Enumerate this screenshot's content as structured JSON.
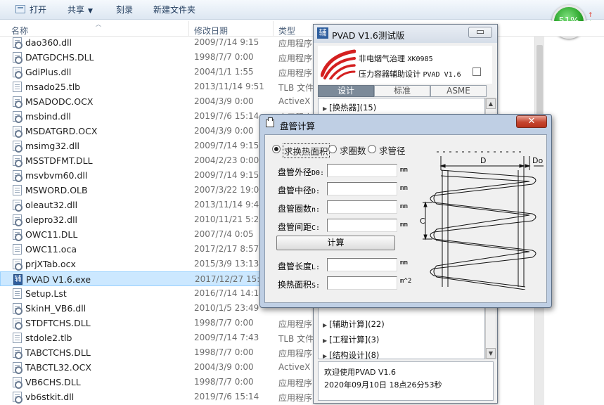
{
  "toolbar": {
    "open_label": "打开",
    "share_label": "共享",
    "burn_label": "刻录",
    "new_folder_label": "新建文件夹"
  },
  "gauge": {
    "percent_label": "51%"
  },
  "columns": {
    "name": "名称",
    "modified": "修改日期",
    "type": "类型"
  },
  "files": [
    {
      "name": "dao360.dll",
      "date": "2009/7/14 9:15",
      "type": "应用程序",
      "icon": "gear"
    },
    {
      "name": "DATGDCHS.DLL",
      "date": "1998/7/7 0:00",
      "type": "应用程序",
      "icon": "gear"
    },
    {
      "name": "GdiPlus.dll",
      "date": "2004/1/1 1:55",
      "type": "应用程序",
      "icon": "gear"
    },
    {
      "name": "msado25.tlb",
      "date": "2013/11/14 9:51",
      "type": "TLB 文件",
      "icon": "doc"
    },
    {
      "name": "MSADODC.OCX",
      "date": "2004/3/9 0:00",
      "type": "ActiveX",
      "icon": "gear"
    },
    {
      "name": "msbind.dll",
      "date": "2019/7/6 15:14",
      "type": "应用程序",
      "icon": "gear"
    },
    {
      "name": "MSDATGRD.OCX",
      "date": "2004/3/9 0:00",
      "type": "ActiveX",
      "icon": "gear"
    },
    {
      "name": "msimg32.dll",
      "date": "2009/7/14 9:15",
      "type": "应用程序",
      "icon": "gear"
    },
    {
      "name": "MSSTDFMT.DLL",
      "date": "2004/2/23 0:00",
      "type": "应用程序",
      "icon": "gear"
    },
    {
      "name": "msvbvm60.dll",
      "date": "2009/7/14 9:15",
      "type": "应用程序",
      "icon": "gear"
    },
    {
      "name": "MSWORD.OLB",
      "date": "2007/3/22 19:05",
      "type": "",
      "icon": "doc"
    },
    {
      "name": "oleaut32.dll",
      "date": "2013/11/14 9:48",
      "type": "",
      "icon": "gear"
    },
    {
      "name": "olepro32.dll",
      "date": "2010/11/21 5:29",
      "type": "",
      "icon": "gear"
    },
    {
      "name": "OWC11.DLL",
      "date": "2007/7/4 0:05",
      "type": "",
      "icon": "gear"
    },
    {
      "name": "OWC11.oca",
      "date": "2017/2/17 8:57",
      "type": "",
      "icon": "doc"
    },
    {
      "name": "prjXTab.ocx",
      "date": "2015/3/9 13:13",
      "type": "",
      "icon": "gear"
    },
    {
      "name": "PVAD V1.6.exe",
      "date": "2017/12/27 15:2",
      "type": "",
      "icon": "exe"
    },
    {
      "name": "Setup.Lst",
      "date": "2016/7/14 14:14",
      "type": "",
      "icon": "doc"
    },
    {
      "name": "SkinH_VB6.dll",
      "date": "2010/1/5 23:49",
      "type": "",
      "icon": "gear"
    },
    {
      "name": "STDFTCHS.DLL",
      "date": "1998/7/7 0:00",
      "type": "应用程序",
      "icon": "gear"
    },
    {
      "name": "stdole2.tlb",
      "date": "2009/7/14 7:43",
      "type": "TLB 文件",
      "icon": "doc"
    },
    {
      "name": "TABCTCHS.DLL",
      "date": "1998/7/7 0:00",
      "type": "应用程序",
      "icon": "gear"
    },
    {
      "name": "TABCTL32.OCX",
      "date": "2004/3/9 0:00",
      "type": "ActiveX",
      "icon": "gear"
    },
    {
      "name": "VB6CHS.DLL",
      "date": "1998/7/7 0:00",
      "type": "应用程序",
      "icon": "gear"
    },
    {
      "name": "vb6stkit.dll",
      "date": "2019/7/6 15:14",
      "type": "应用程序",
      "icon": "gear"
    }
  ],
  "pvad": {
    "title": "PVAD  V1.6测试版",
    "close_glyph": "▭",
    "brand_line1_cn": "非电烟气治理 ",
    "brand_line1_en": "XK0985",
    "brand_line2_cn": "压力容器辅助设计 ",
    "brand_line2_en": "PVAD V1.6",
    "tabs": [
      "设计",
      "标准",
      "ASME"
    ],
    "tree_items": [
      "[换热器](15)",
      "[辅助计算](22)",
      "[工程计算](3)",
      "[结构设计](8)"
    ],
    "status_line1": "欢迎使用PVAD V1.6",
    "status_line2": "2020年09月10日 18点26分53秒"
  },
  "dialog": {
    "title": "盘管计算",
    "close_glyph": "✕",
    "radio_options": [
      "求换热面积",
      "求圈数",
      "求管径"
    ],
    "selected_radio": 0,
    "fields": [
      {
        "label_cn": "盘管外径",
        "label_en": "D0:",
        "value": "",
        "unit": "mm"
      },
      {
        "label_cn": "盘管中径",
        "label_en": "D:",
        "value": "",
        "unit": "mm"
      },
      {
        "label_cn": "盘管圈数",
        "label_en": "n:",
        "value": "",
        "unit": "mm"
      },
      {
        "label_cn": "盘管间距",
        "label_en": "C:",
        "value": "",
        "unit": "mm"
      }
    ],
    "calc_label": "计算",
    "results": [
      {
        "label_cn": "盘管长度",
        "label_en": "L:",
        "value": "",
        "unit": "mm"
      },
      {
        "label_cn": "换热面积",
        "label_en": "S:",
        "value": "",
        "unit": "m^2"
      }
    ],
    "diagram_labels": {
      "d": "D",
      "do": "Do",
      "c": "C"
    }
  },
  "colors": {
    "dialog_frame": "#bfcfe4",
    "close_red": "#c5452f",
    "tab_active": "#7c8a99",
    "brand_red": "#d42020",
    "selected_row": "#cce8ff"
  }
}
